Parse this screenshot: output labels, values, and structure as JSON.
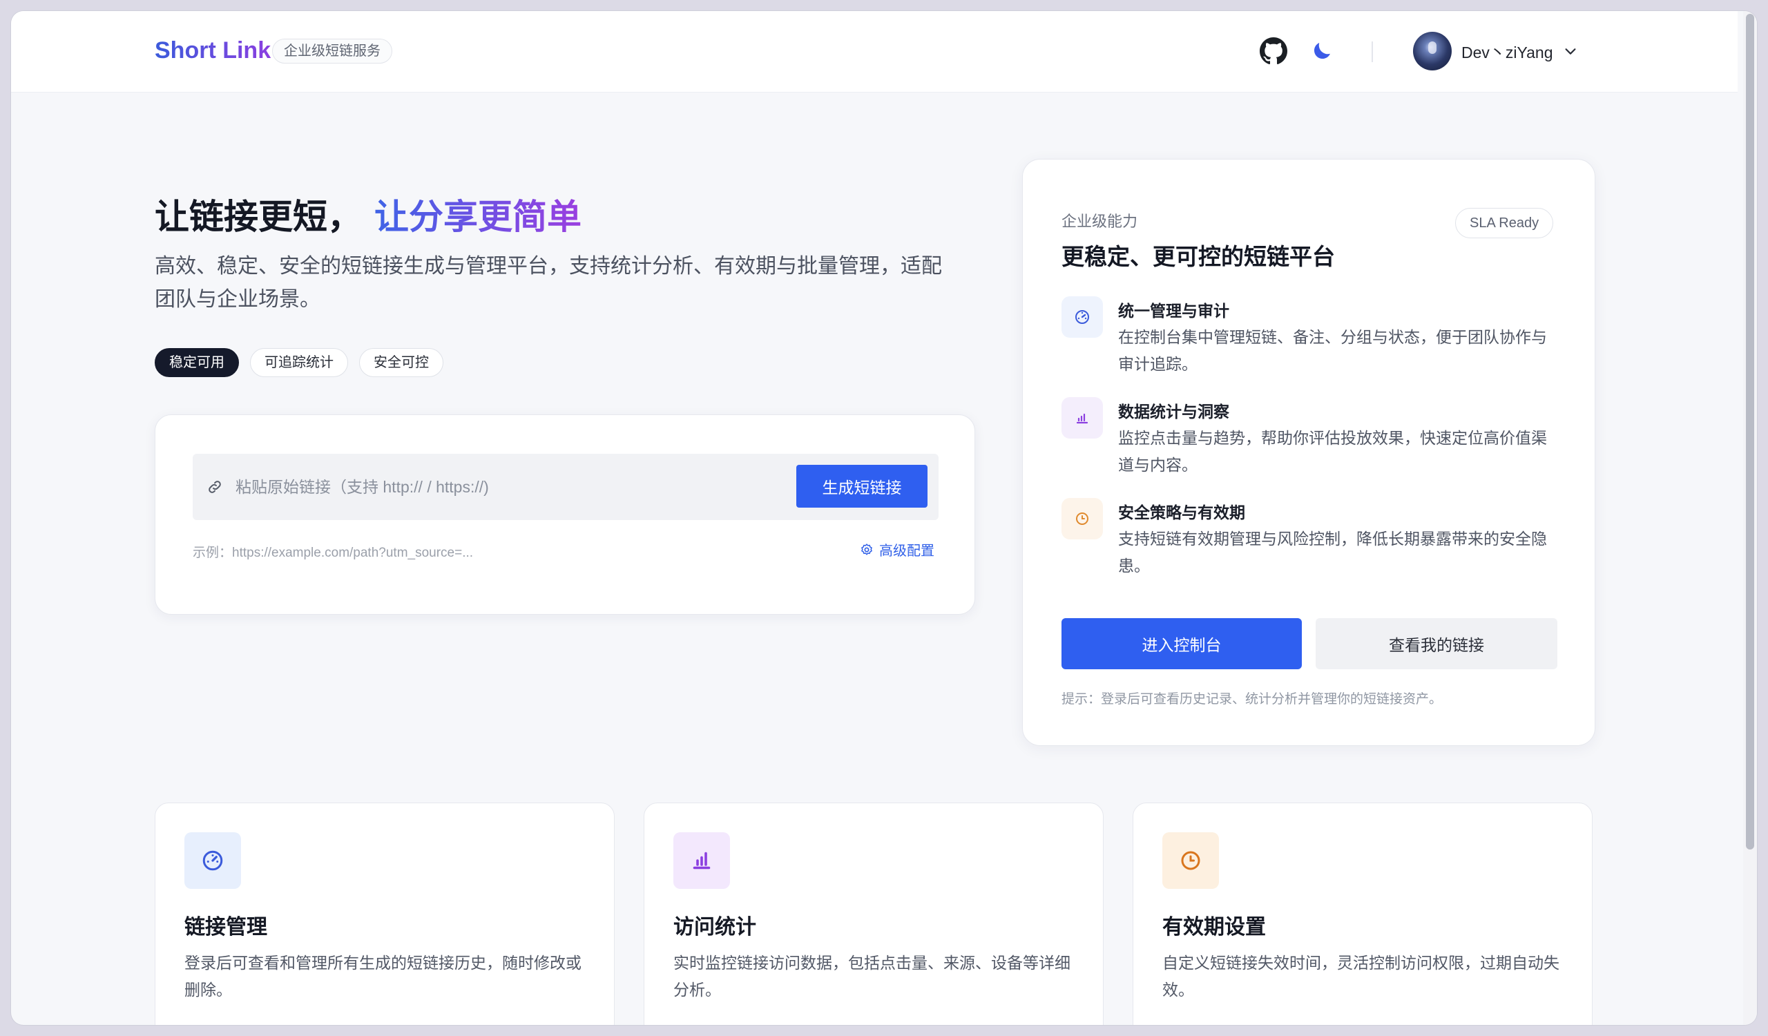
{
  "header": {
    "logo": "Short Link",
    "tagline": "企业级短链服务",
    "user_name": "Dev丶ziYang"
  },
  "hero": {
    "title_main": "让链接更短，",
    "title_accent": "让分享更简单",
    "description": "高效、稳定、安全的短链接生成与管理平台，支持统计分析、有效期与批量管理，适配团队与企业场景。",
    "chips": [
      "稳定可用",
      "可追踪统计",
      "安全可控"
    ]
  },
  "shortener": {
    "placeholder": "粘贴原始链接（支持 http:// / https://)",
    "generate_label": "生成短链接",
    "example": "示例：https://example.com/path?utm_source=...",
    "advanced_label": "高级配置"
  },
  "panel": {
    "eyebrow": "企业级能力",
    "title": "更稳定、更可控的短链平台",
    "badge": "SLA Ready",
    "features": [
      {
        "title": "统一管理与审计",
        "desc": "在控制台集中管理短链、备注、分组与状态，便于团队协作与审计追踪。"
      },
      {
        "title": "数据统计与洞察",
        "desc": "监控点击量与趋势，帮助你评估投放效果，快速定位高价值渠道与内容。"
      },
      {
        "title": "安全策略与有效期",
        "desc": "支持短链有效期管理与风险控制，降低长期暴露带来的安全隐患。"
      }
    ],
    "primary_label": "进入控制台",
    "secondary_label": "查看我的链接",
    "hint": "提示：登录后可查看历史记录、统计分析并管理你的短链接资产。"
  },
  "cards": [
    {
      "title": "链接管理",
      "desc": "登录后可查看和管理所有生成的短链接历史，随时修改或删除。"
    },
    {
      "title": "访问统计",
      "desc": "实时监控链接访问数据，包括点击量、来源、设备等详细分析。"
    },
    {
      "title": "有效期设置",
      "desc": "自定义短链接失效时间，灵活控制访问权限，过期自动失效。"
    }
  ],
  "colors": {
    "primary": "#2f5ff0",
    "accent_purple": "#9a3fe0",
    "dark_chip": "#151a2b",
    "icon_blue_bg": "#e8f0fe",
    "icon_purple_bg": "#f3e8fd",
    "icon_orange_bg": "#fdf0e0"
  }
}
